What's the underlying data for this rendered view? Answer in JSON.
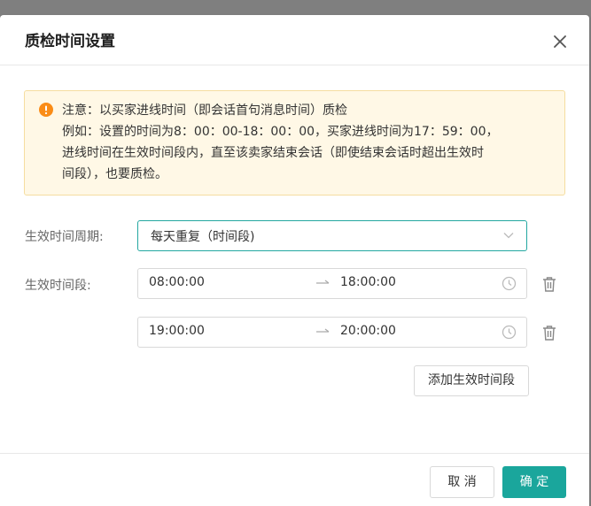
{
  "dialog": {
    "title": "质检时间设置",
    "close_icon": "close-icon"
  },
  "notice": {
    "icon": "warning-icon",
    "lines": [
      "注意：以买家进线时间（即会话首句消息时间）质检",
      "例如：设置的时间为8：00：00-18：00：00，买家进线时间为17：59：00，",
      "进线时间在生效时间段内，直至该卖家结束会话（即使结束会话时超出生效时",
      "间段），也要质检。"
    ]
  },
  "form": {
    "period_label": "生效时间周期:",
    "period_value": "每天重复（时间段)",
    "range_label": "生效时间段:",
    "ranges": [
      {
        "start": "08:00:00",
        "end": "18:00:00"
      },
      {
        "start": "19:00:00",
        "end": "20:00:00"
      }
    ],
    "add_button": "添加生效时间段"
  },
  "footer": {
    "cancel": "取 消",
    "ok": "确 定"
  },
  "colors": {
    "accent": "#1aa69c",
    "warning": "#fa8c16",
    "notice_bg": "#fff8e6"
  }
}
